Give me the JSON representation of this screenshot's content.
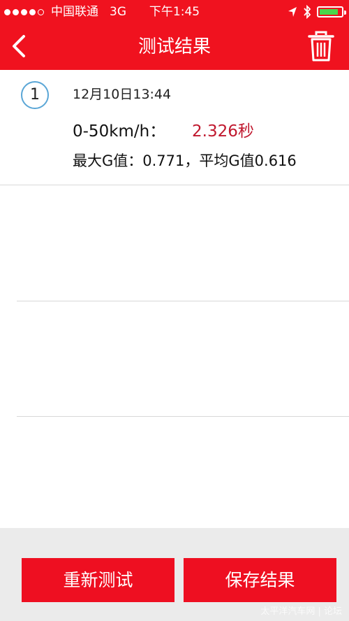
{
  "status_bar": {
    "carrier": "中国联通",
    "network": "3G",
    "time": "下午1:45",
    "battery_level": 0.85
  },
  "nav": {
    "title": "测试结果",
    "back_icon": "chevron-left-icon",
    "trash_icon": "trash-icon"
  },
  "results": [
    {
      "index": "1",
      "timestamp": "12月10日13:44",
      "speed_range": "0-50km/h：",
      "time": "2.326秒",
      "g_values": "最大G值：0.771，平均G值0.616"
    }
  ],
  "buttons": {
    "retest": "重新测试",
    "save": "保存结果"
  },
  "watermark": "太平洋汽车网 | 论坛",
  "colors": {
    "brand_red": "#f0121f",
    "value_red": "#c0182e",
    "badge_blue": "#5aa6d6",
    "battery_green": "#49d64a"
  }
}
